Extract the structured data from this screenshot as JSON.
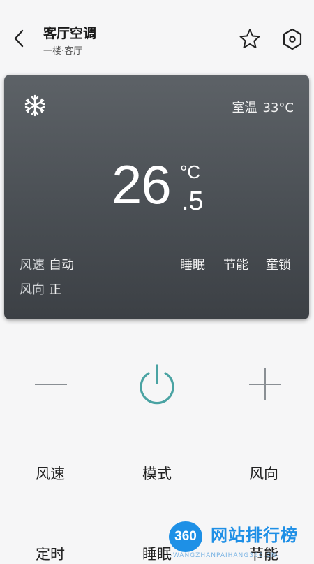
{
  "header": {
    "title": "客厅空调",
    "subtitle": "一楼·客厅",
    "icons": [
      "back-arrow-icon",
      "star-icon",
      "settings-hexagon-icon"
    ]
  },
  "card": {
    "mode_icon": "snowflake-icon",
    "room_label": "室温",
    "room_value": "33°C",
    "temp_integer": "26",
    "temp_decimal": ".5",
    "temp_unit": "°C",
    "fan_speed_label": "风速",
    "fan_speed_value": "自动",
    "fan_dir_label": "风向",
    "fan_dir_value": "正",
    "flags": [
      "睡眠",
      "节能",
      "童锁"
    ]
  },
  "controls": {
    "icons": [
      "minus-icon",
      "power-icon",
      "plus-icon"
    ],
    "accent": "#4aa3a3"
  },
  "functions_row1": [
    "风速",
    "模式",
    "风向"
  ],
  "functions_row2": [
    "定时",
    "睡眠",
    "节能"
  ],
  "watermark": {
    "badge": "360",
    "name": "网站排行榜",
    "domain": "-WANGZHANPAIHANG360.CN-"
  }
}
